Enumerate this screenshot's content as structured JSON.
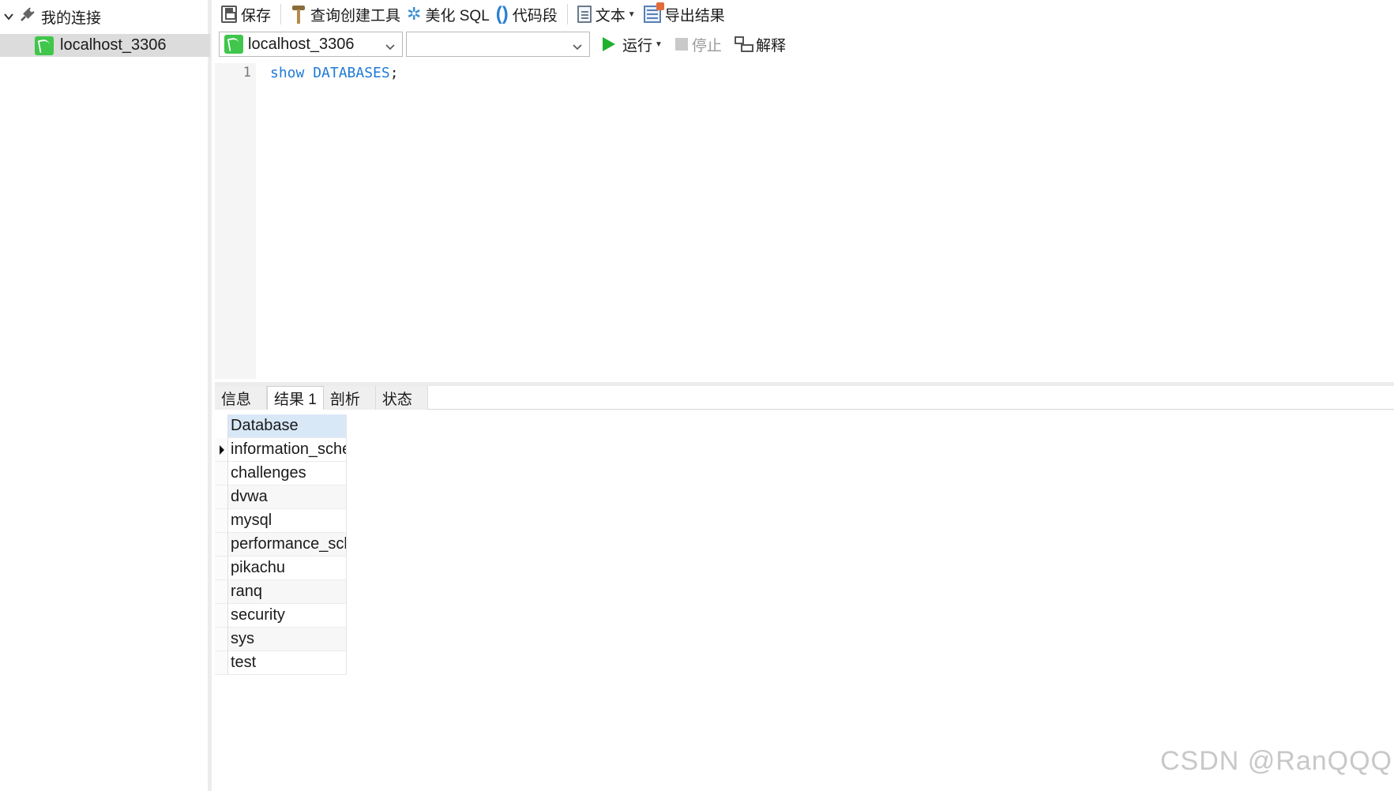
{
  "sidebar": {
    "root_label": "我的连接",
    "connection_label": "localhost_3306"
  },
  "toolbar": {
    "save": "保存",
    "query_builder": "查询创建工具",
    "beautify": "美化 SQL",
    "snippet": "代码段",
    "text": "文本",
    "export": "导出结果"
  },
  "toolbar2": {
    "connection_value": "localhost_3306",
    "database_value": "",
    "run": "运行",
    "stop": "停止",
    "explain": "解释"
  },
  "editor": {
    "line_number": "1",
    "code_keyword1": "show",
    "code_keyword2": "DATABASES",
    "code_punct": ";"
  },
  "result_tabs": [
    "信息",
    "结果 1",
    "剖析",
    "状态"
  ],
  "results": {
    "column": "Database",
    "rows": [
      "information_sche",
      "challenges",
      "dvwa",
      "mysql",
      "performance_sche",
      "pikachu",
      "ranq",
      "security",
      "sys",
      "test"
    ]
  },
  "watermark": "CSDN @RanQQQ",
  "colors": {
    "run_green": "#22b02f",
    "keyword_blue": "#1f7ad6",
    "header_blue": "#d9e8f7",
    "connection_green": "#3fc64b"
  }
}
